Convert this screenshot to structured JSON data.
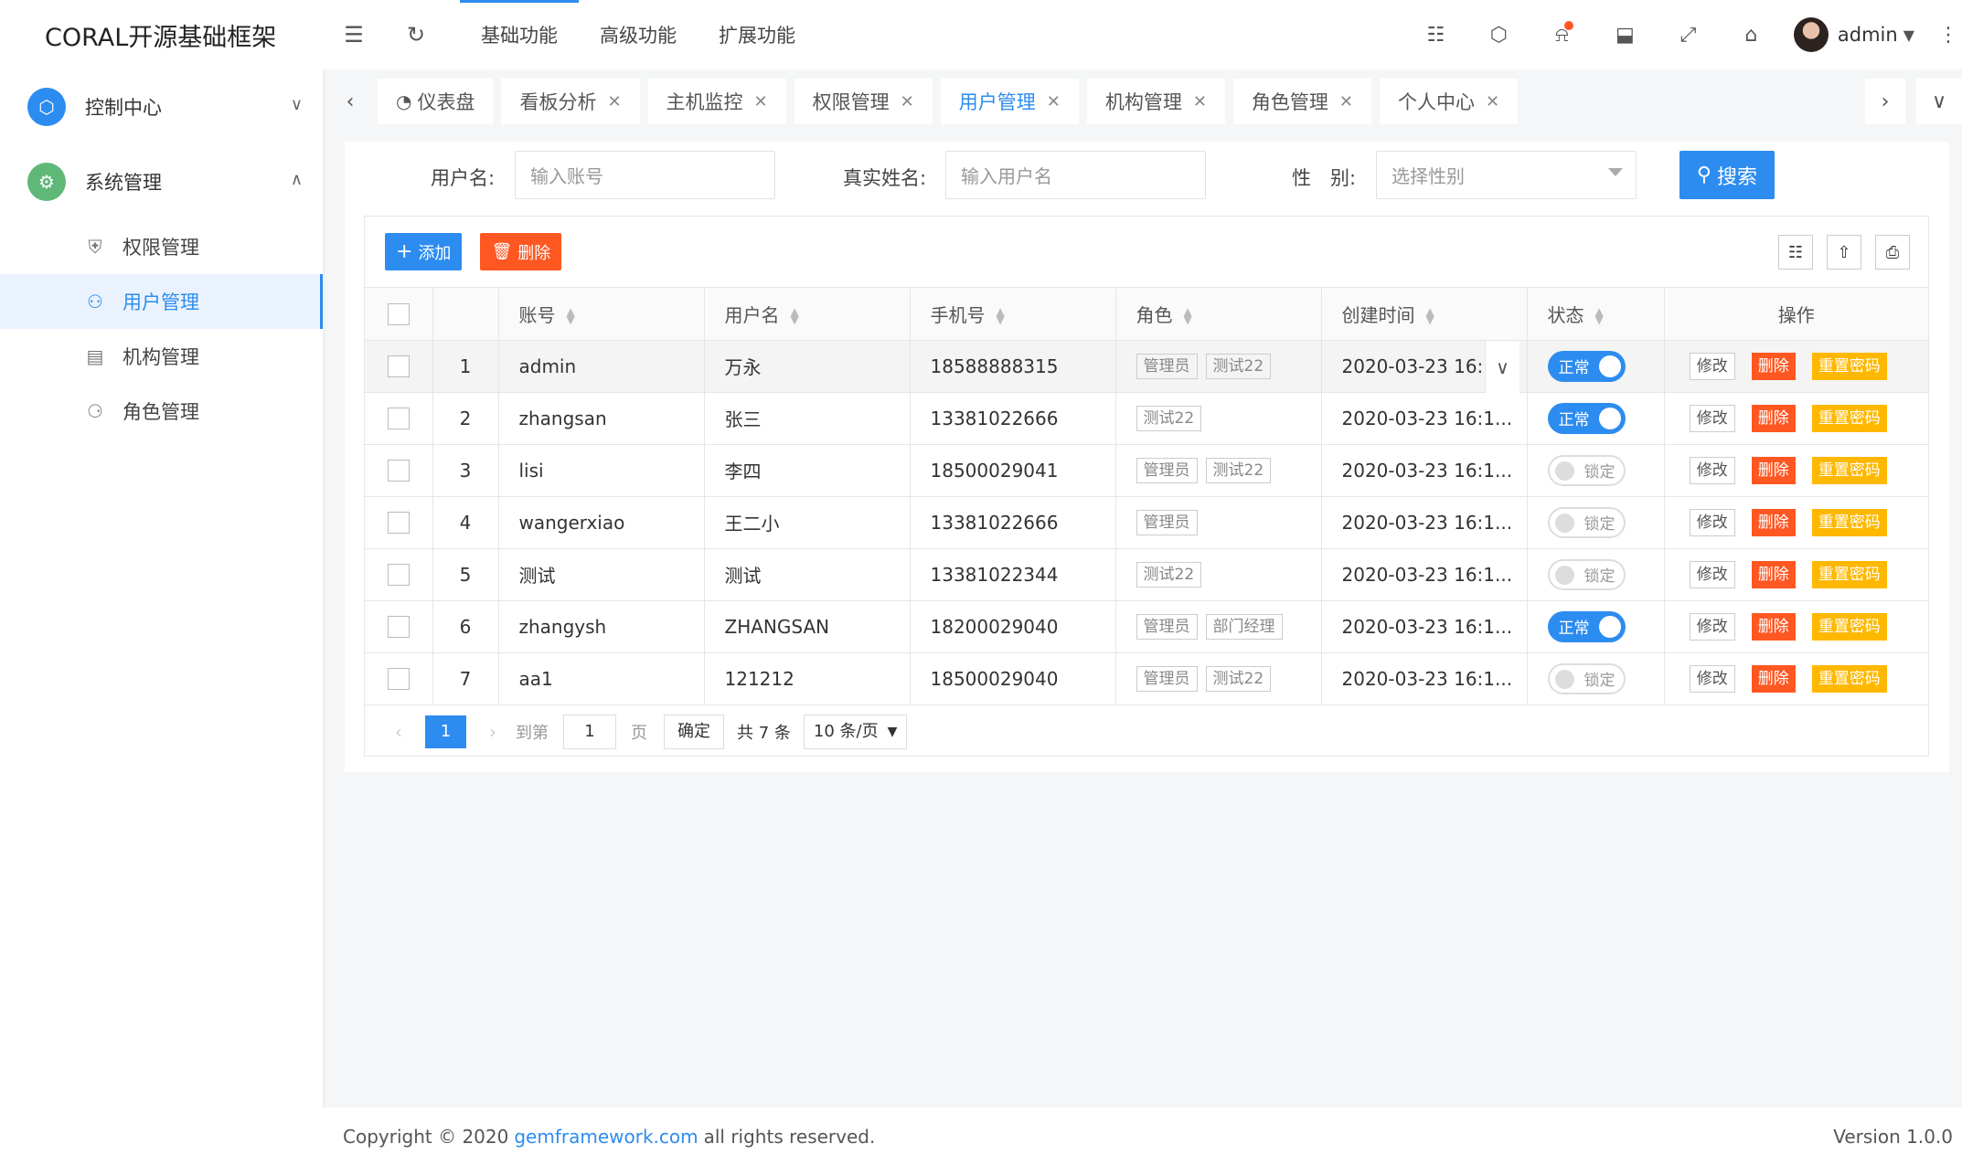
{
  "app": {
    "title": "CORAL开源基础框架"
  },
  "sidebar": {
    "groups": [
      {
        "label": "控制中心",
        "icon": "cube-icon",
        "color": "#2d8cf0"
      },
      {
        "label": "系统管理",
        "icon": "gear-icon",
        "color": "#5fb878"
      }
    ],
    "items": [
      {
        "label": "权限管理",
        "icon": "shield-icon"
      },
      {
        "label": "用户管理",
        "icon": "user-icon"
      },
      {
        "label": "机构管理",
        "icon": "calendar-icon"
      },
      {
        "label": "角色管理",
        "icon": "users-icon"
      }
    ]
  },
  "topbar": {
    "nav": [
      "基础功能",
      "高级功能",
      "扩展功能"
    ],
    "user": "admin"
  },
  "tabs": [
    {
      "label": "仪表盘",
      "closable": false
    },
    {
      "label": "看板分析",
      "closable": true
    },
    {
      "label": "主机监控",
      "closable": true
    },
    {
      "label": "权限管理",
      "closable": true
    },
    {
      "label": "用户管理",
      "closable": true
    },
    {
      "label": "机构管理",
      "closable": true
    },
    {
      "label": "角色管理",
      "closable": true
    },
    {
      "label": "个人中心",
      "closable": true
    }
  ],
  "search": {
    "account_label": "用户名:",
    "account_placeholder": "输入账号",
    "realname_label": "真实姓名:",
    "realname_placeholder": "输入用户名",
    "gender_label": "性　别:",
    "gender_placeholder": "选择性别",
    "search_button": "搜索"
  },
  "toolbar": {
    "add": "添加",
    "delete": "删除"
  },
  "table": {
    "columns": [
      "账号",
      "用户名",
      "手机号",
      "角色",
      "创建时间",
      "状态",
      "操作"
    ],
    "rows": [
      {
        "no": "1",
        "account": "admin",
        "name": "万永",
        "phone": "18588888315",
        "roles": [
          "管理员",
          "测试22"
        ],
        "created": "2020-03-23 16:1...",
        "status": "正常",
        "on": true
      },
      {
        "no": "2",
        "account": "zhangsan",
        "name": "张三",
        "phone": "13381022666",
        "roles": [
          "测试22"
        ],
        "created": "2020-03-23 16:1...",
        "status": "正常",
        "on": true
      },
      {
        "no": "3",
        "account": "lisi",
        "name": "李四",
        "phone": "18500029041",
        "roles": [
          "管理员",
          "测试22"
        ],
        "created": "2020-03-23 16:1...",
        "status": "锁定",
        "on": false
      },
      {
        "no": "4",
        "account": "wangerxiao",
        "name": "王二小",
        "phone": "13381022666",
        "roles": [
          "管理员"
        ],
        "created": "2020-03-23 16:1...",
        "status": "锁定",
        "on": false
      },
      {
        "no": "5",
        "account": "测试",
        "name": "测试",
        "phone": "13381022344",
        "roles": [
          "测试22"
        ],
        "created": "2020-03-23 16:1...",
        "status": "锁定",
        "on": false
      },
      {
        "no": "6",
        "account": "zhangysh",
        "name": "ZHANGSAN",
        "phone": "18200029040",
        "roles": [
          "管理员",
          "部门经理"
        ],
        "created": "2020-03-23 16:1...",
        "status": "正常",
        "on": true
      },
      {
        "no": "7",
        "account": "aa1",
        "name": "121212",
        "phone": "18500029040",
        "roles": [
          "管理员",
          "测试22"
        ],
        "created": "2020-03-23 16:1...",
        "status": "锁定",
        "on": false
      }
    ],
    "actions": {
      "edit": "修改",
      "delete": "删除",
      "reset": "重置密码"
    }
  },
  "pager": {
    "current": "1",
    "goto_label": "到第",
    "goto_value": "1",
    "page_label": "页",
    "confirm": "确定",
    "total": "共 7 条",
    "page_size": "10 条/页"
  },
  "footer": {
    "copyright_prefix": "Copyright © 2020",
    "link": "gemframework.com",
    "copyright_suffix": "all rights reserved.",
    "version": "Version 1.0.0"
  }
}
